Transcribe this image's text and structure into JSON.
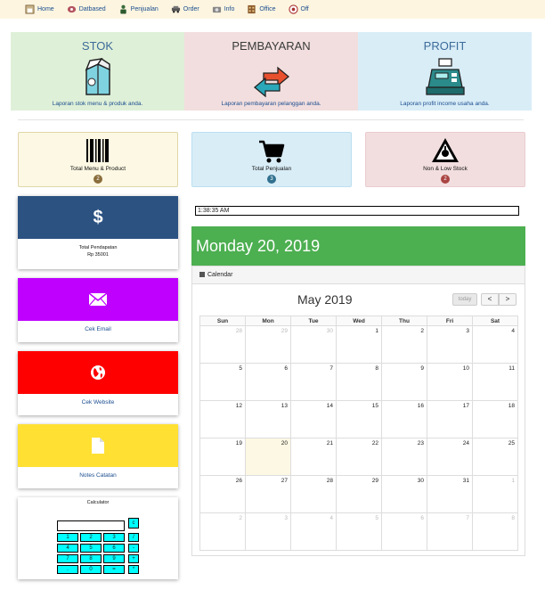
{
  "nav": [
    {
      "label": "Home",
      "icon": "home-icon"
    },
    {
      "label": "Datbased",
      "icon": "database-icon"
    },
    {
      "label": "Penjualan",
      "icon": "person-icon"
    },
    {
      "label": "Order",
      "icon": "car-icon"
    },
    {
      "label": "Info",
      "icon": "info-icon"
    },
    {
      "label": "Office",
      "icon": "office-icon"
    },
    {
      "label": "Off",
      "icon": "power-icon"
    }
  ],
  "panels": [
    {
      "title": "STOK",
      "desc": "Laporan stok menu & produk anda.",
      "icon": "milk-carton-icon",
      "bg": "#dff0d8"
    },
    {
      "title": "PEMBAYARAN",
      "desc": "Laporan pembayaran pelanggan anda.",
      "icon": "exchange-arrows-icon",
      "bg": "#f2dede"
    },
    {
      "title": "PROFIT",
      "desc": "Laporan profit income usaha anda.",
      "icon": "cash-register-icon",
      "bg": "#d9edf7"
    }
  ],
  "stats": [
    {
      "label": "Total Menu & Product",
      "badge": "2",
      "icon": "barcode-icon",
      "bg": "#fcf8e3",
      "badge_color": "#8a6d3b"
    },
    {
      "label": "Total Penjualan",
      "badge": "3",
      "icon": "cart-icon",
      "bg": "#d9edf7",
      "badge_color": "#31708f"
    },
    {
      "label": "Non & Low Stock",
      "badge": "2",
      "icon": "warning-icon",
      "bg": "#f2dede",
      "badge_color": "#a94442"
    }
  ],
  "cards": [
    {
      "label_line1": "Total Pendapatan",
      "label_line2": "Rp 35001",
      "icon_char": "$",
      "color": "#2c5282"
    },
    {
      "label": "Cek Email",
      "color": "#bf00ff"
    },
    {
      "label": "Cek Website",
      "color": "#ff0000"
    },
    {
      "label": "Notes Catatan",
      "color": "#ffe033"
    }
  ],
  "calculator": {
    "title": "Calculator",
    "display": "",
    "clear": "c",
    "rows": [
      [
        "1",
        "2",
        "3",
        "/"
      ],
      [
        "4",
        "5",
        "6",
        "-"
      ],
      [
        "7",
        "8",
        "9",
        "+"
      ],
      [
        ".",
        "0",
        "=",
        "*"
      ]
    ]
  },
  "clock": "1:38:35 AM",
  "date_banner": "Monday 20, 2019",
  "calendar": {
    "header": "Calendar",
    "month": "May 2019",
    "today_btn": "today",
    "prev": "<",
    "next": ">",
    "days": [
      "Sun",
      "Mon",
      "Tue",
      "Wed",
      "Thu",
      "Fri",
      "Sat"
    ],
    "weeks": [
      [
        "28",
        "29",
        "30",
        "1",
        "2",
        "3",
        "4"
      ],
      [
        "5",
        "6",
        "7",
        "8",
        "9",
        "10",
        "11"
      ],
      [
        "12",
        "13",
        "14",
        "15",
        "16",
        "17",
        "18"
      ],
      [
        "19",
        "20",
        "21",
        "22",
        "23",
        "24",
        "25"
      ],
      [
        "26",
        "27",
        "28",
        "29",
        "30",
        "31",
        "1"
      ],
      [
        "2",
        "3",
        "4",
        "5",
        "6",
        "7",
        "8"
      ]
    ]
  }
}
